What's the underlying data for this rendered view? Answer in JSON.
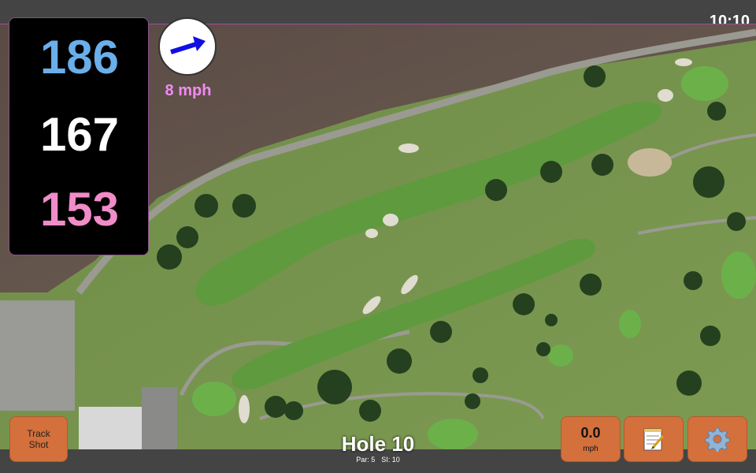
{
  "status": {
    "time": "10:10"
  },
  "yardages": {
    "back": "186",
    "middle": "167",
    "front": "153"
  },
  "wind": {
    "speed_label": "8 mph",
    "direction_icon": "arrow-northeast-icon",
    "arrow_color": "#1010e0"
  },
  "buttons": {
    "track_shot_line1": "Track",
    "track_shot_line2": "Shot",
    "speed_value": "0.0",
    "speed_unit": "mph",
    "notes_icon": "notepad-icon",
    "settings_icon": "gear-icon"
  },
  "hole": {
    "title": "Hole 10",
    "par_label": "Par: 5",
    "si_label": "SI: 10"
  },
  "colors": {
    "back_yardage": "#6aaeea",
    "middle_yardage": "#ffffff",
    "front_yardage": "#f08cc8",
    "button": "#d4703c",
    "wind_text": "#f08cf0"
  }
}
